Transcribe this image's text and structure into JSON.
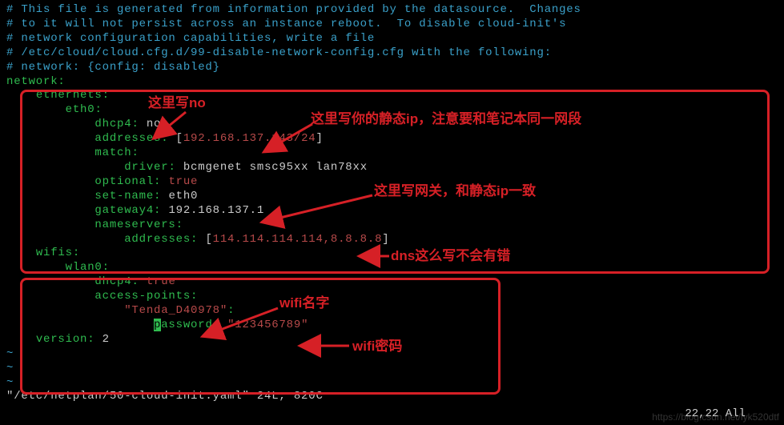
{
  "lines": {
    "c1": "# This file is generated from information provided by the datasource.  Changes",
    "c2": "# to it will not persist across an instance reboot.  To disable cloud-init's",
    "c3": "# network configuration capabilities, write a file",
    "c4": "# /etc/cloud/cloud.cfg.d/99-disable-network-config.cfg with the following:",
    "c5": "# network: {config: disabled}"
  },
  "yaml": {
    "network": "network",
    "ethernets": "ethernets",
    "eth0": "eth0",
    "dhcp4": "dhcp4",
    "dhcp4_val": "no",
    "addresses": "addresses",
    "addresses_val": "192.168.137.143/24",
    "match": "match",
    "driver": "driver",
    "driver_val": "bcmgenet smsc95xx lan78xx",
    "optional": "optional",
    "optional_val": "true",
    "setname": "set-name",
    "setname_val": "eth0",
    "gateway4": "gateway4",
    "gateway4_val": "192.168.137.1",
    "nameservers": "nameservers",
    "ns_addresses": "addresses",
    "ns_val": "114.114.114.114,8.8.8.8",
    "wifis": "wifis",
    "wlan0": "wlan0",
    "w_dhcp4": "dhcp4",
    "w_dhcp4_val": "true",
    "access_points": "access-points",
    "ap_name": "\"Tenda_D40978\"",
    "password_key_pre": "p",
    "password_key_rest": "assword",
    "password_val": "\"123456789\"",
    "version": "version",
    "version_val": "2"
  },
  "tilde": "~",
  "status_left": "\"/etc/netplan/50-cloud-init.yaml\" 24L, 820C",
  "status_right": "22,22         All",
  "annotations": {
    "no": "这里写no",
    "ip": "这里写你的静态ip，注意要和笔记本同一网段",
    "gw": "这里写网关，和静态ip一致",
    "dns": "dns这么写不会有错",
    "winame": "wifi名字",
    "wipwd": "wifi密码"
  },
  "watermark": "https://blog.csdn.net/lyk520dtf"
}
